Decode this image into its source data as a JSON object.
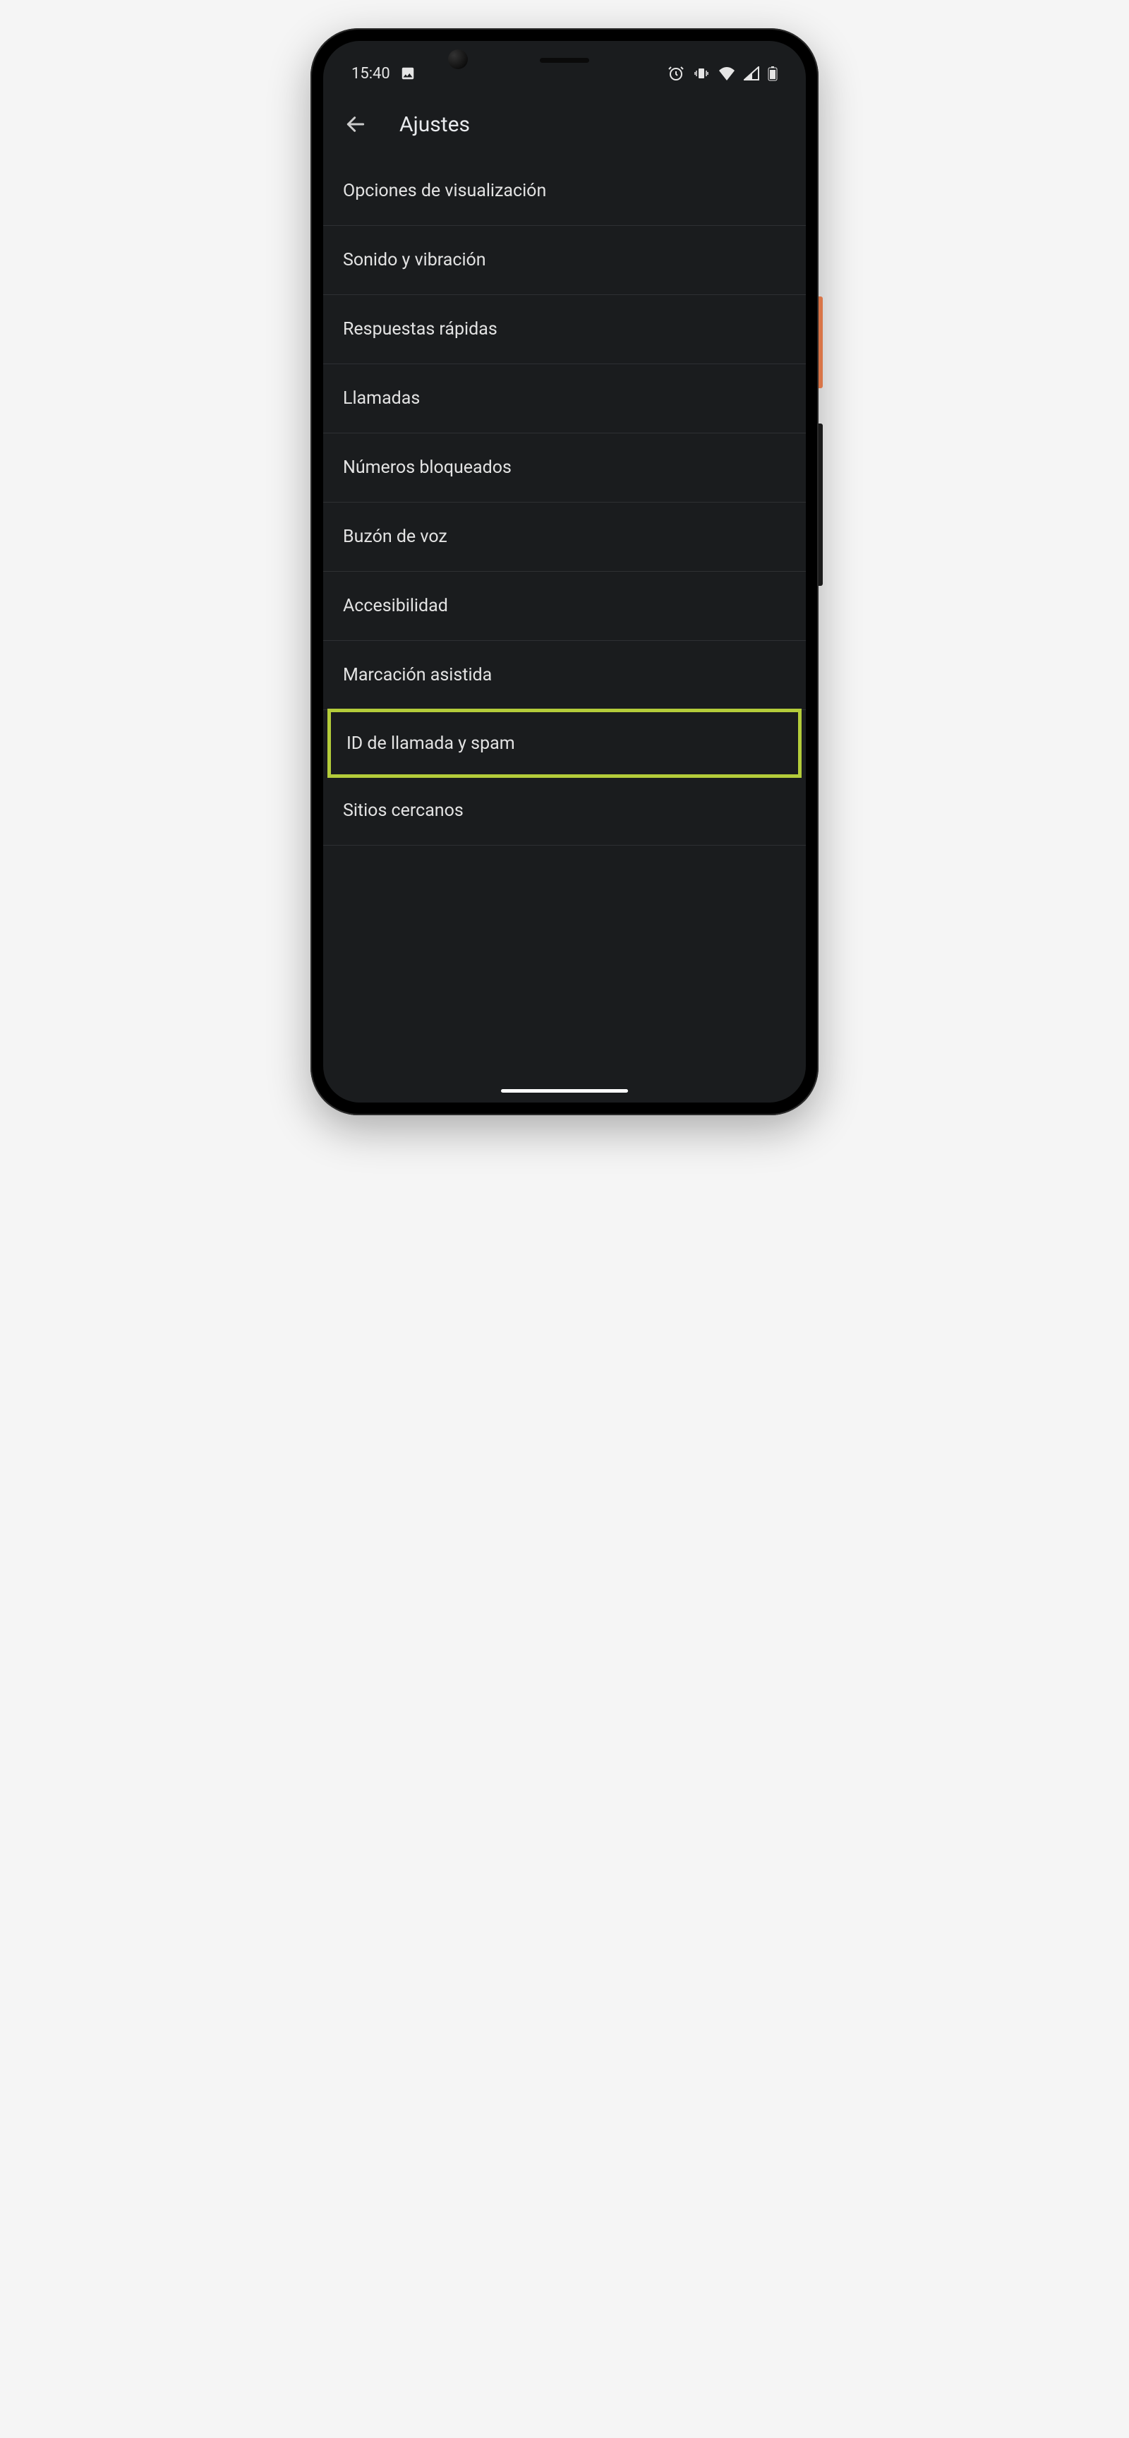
{
  "statusBar": {
    "time": "15:40",
    "icons": {
      "picture": "picture-icon",
      "alarm": "alarm-icon",
      "vibrate": "vibrate-icon",
      "wifi": "wifi-icon",
      "signal": "signal-icon",
      "battery": "battery-icon"
    }
  },
  "appBar": {
    "title": "Ajustes"
  },
  "settings": {
    "items": [
      {
        "label": "Opciones de visualización",
        "highlighted": false
      },
      {
        "label": "Sonido y vibración",
        "highlighted": false
      },
      {
        "label": "Respuestas rápidas",
        "highlighted": false
      },
      {
        "label": "Llamadas",
        "highlighted": false
      },
      {
        "label": "Números bloqueados",
        "highlighted": false
      },
      {
        "label": "Buzón de voz",
        "highlighted": false
      },
      {
        "label": "Accesibilidad",
        "highlighted": false
      },
      {
        "label": "Marcación asistida",
        "highlighted": false
      },
      {
        "label": "ID de llamada y spam",
        "highlighted": true
      },
      {
        "label": "Sitios cercanos",
        "highlighted": false
      }
    ]
  }
}
